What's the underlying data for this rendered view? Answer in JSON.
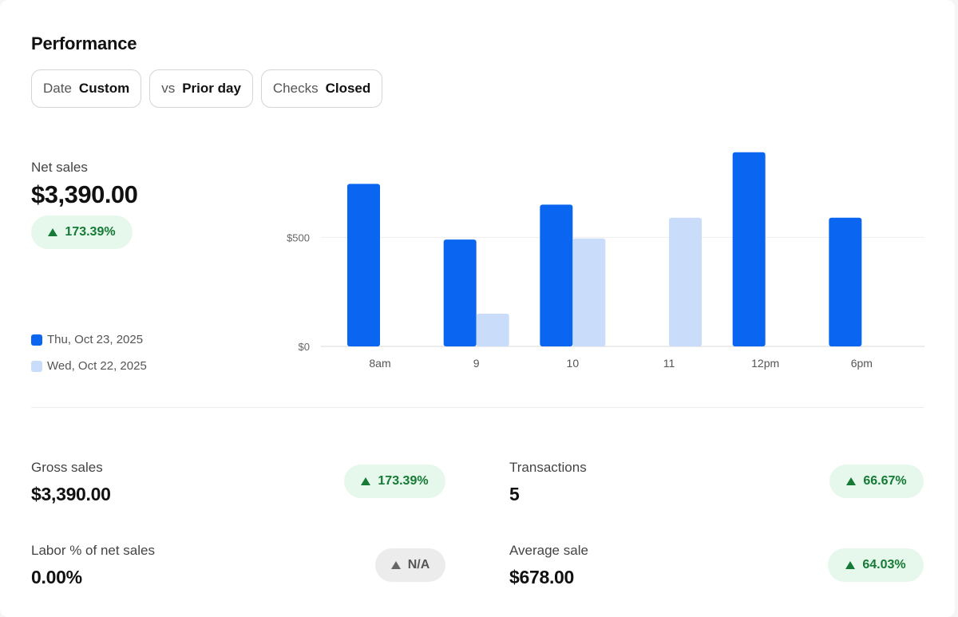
{
  "title": "Performance",
  "filters": [
    {
      "key": "Date",
      "value": "Custom"
    },
    {
      "key": "vs",
      "value": "Prior day"
    },
    {
      "key": "Checks",
      "value": "Closed"
    }
  ],
  "net_sales": {
    "label": "Net sales",
    "value": "$3,390.00",
    "change": "173.39%"
  },
  "legend": [
    {
      "label": "Thu, Oct 23, 2025",
      "color": "#0a66f0"
    },
    {
      "label": "Wed, Oct 22, 2025",
      "color": "#c9ddfb"
    }
  ],
  "chart_data": {
    "type": "bar",
    "categories": [
      "8am",
      "9",
      "10",
      "11",
      "12pm",
      "6pm"
    ],
    "series": [
      {
        "name": "Thu, Oct 23, 2025",
        "color": "#0a66f0",
        "values": [
          745,
          490,
          650,
          0,
          890,
          590
        ]
      },
      {
        "name": "Wed, Oct 22, 2025",
        "color": "#c9ddfb",
        "values": [
          0,
          150,
          495,
          590,
          0,
          0
        ]
      }
    ],
    "y_ticks": [
      {
        "value": 0,
        "label": "$0"
      },
      {
        "value": 500,
        "label": "$500"
      }
    ],
    "ylim": [
      0,
      900
    ],
    "grid": true
  },
  "metrics": {
    "gross_sales": {
      "label": "Gross sales",
      "value": "$3,390.00",
      "change": "173.39%"
    },
    "transactions": {
      "label": "Transactions",
      "value": "5",
      "change": "66.67%"
    },
    "labor": {
      "label": "Labor % of net sales",
      "value": "0.00%",
      "change": "N/A"
    },
    "average_sale": {
      "label": "Average sale",
      "value": "$678.00",
      "change": "64.03%"
    }
  }
}
